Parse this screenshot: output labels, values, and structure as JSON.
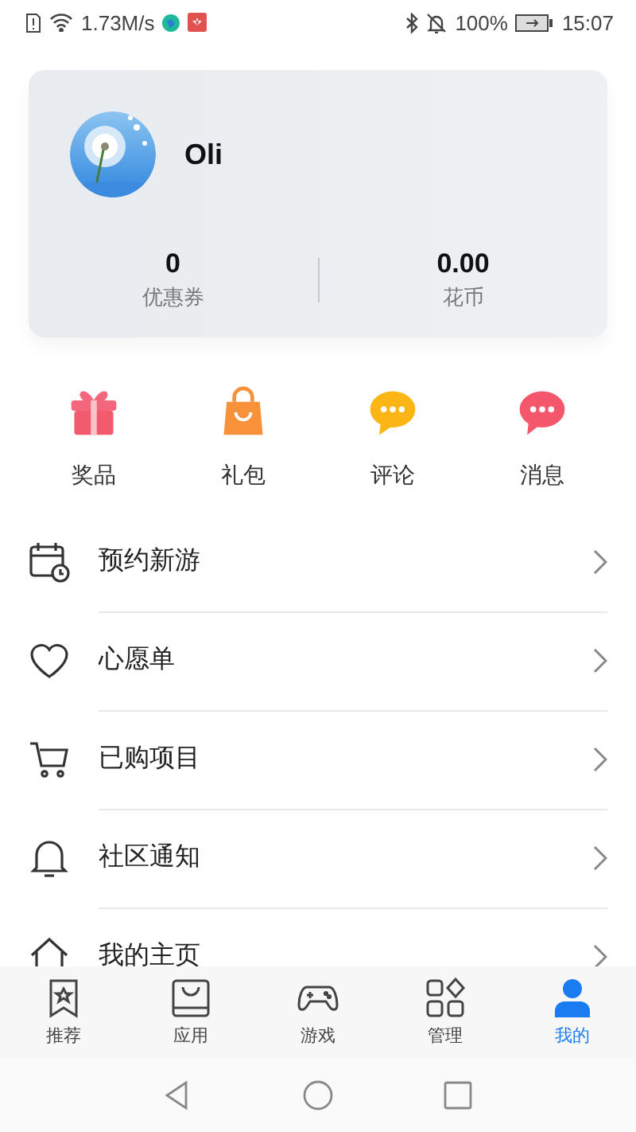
{
  "status_bar": {
    "network_speed": "1.73M/s",
    "battery": "100%",
    "time": "15:07"
  },
  "profile": {
    "name": "Oli",
    "stats": [
      {
        "value": "0",
        "label": "优惠券"
      },
      {
        "value": "0.00",
        "label": "花币"
      }
    ]
  },
  "shortcuts": [
    {
      "label": "奖品",
      "kind": "gift"
    },
    {
      "label": "礼包",
      "kind": "bag"
    },
    {
      "label": "评论",
      "kind": "comment"
    },
    {
      "label": "消息",
      "kind": "message"
    }
  ],
  "menu": [
    {
      "label": "预约新游",
      "kind": "calendar"
    },
    {
      "label": "心愿单",
      "kind": "heart"
    },
    {
      "label": "已购项目",
      "kind": "cart"
    },
    {
      "label": "社区通知",
      "kind": "bell"
    },
    {
      "label": "我的主页",
      "kind": "home"
    }
  ],
  "bottom_nav": [
    {
      "label": "推荐",
      "kind": "bookmark",
      "selected": false
    },
    {
      "label": "应用",
      "kind": "store",
      "selected": false
    },
    {
      "label": "游戏",
      "kind": "gamepad",
      "selected": false
    },
    {
      "label": "管理",
      "kind": "grid",
      "selected": false
    },
    {
      "label": "我的",
      "kind": "person",
      "selected": true
    }
  ]
}
